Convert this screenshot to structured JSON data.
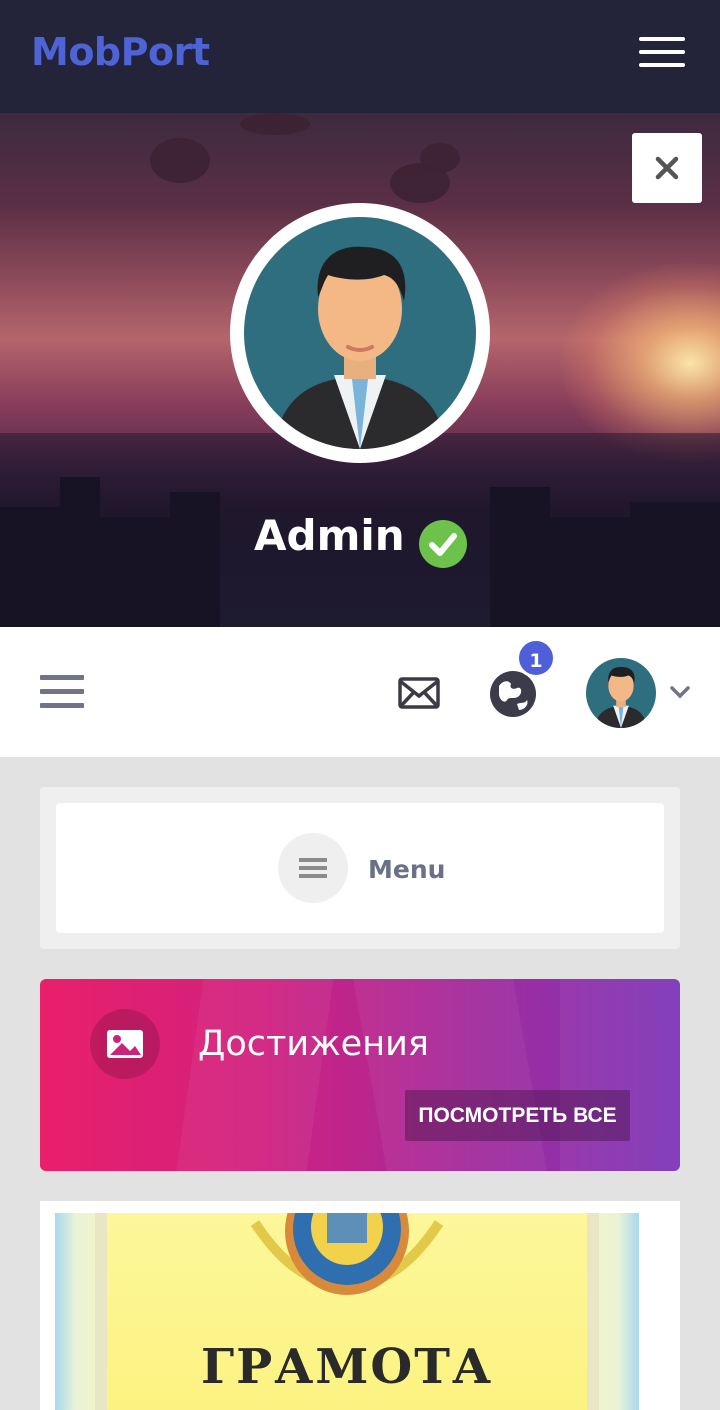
{
  "header": {
    "brand": "MobPort",
    "menu_icon": "hamburger-icon"
  },
  "profile": {
    "name": "Admin",
    "verified": true,
    "verified_icon": "check-circle-icon",
    "close_icon": "close-icon",
    "avatar": "user-avatar-businessman"
  },
  "toolbar": {
    "menu_icon": "hamburger-icon",
    "mail_icon": "envelope-icon",
    "globe_icon": "globe-icon",
    "notification_count": "1",
    "avatar": "user-avatar-businessman",
    "dropdown_icon": "chevron-down-icon"
  },
  "menu_card": {
    "label": "Menu",
    "icon": "list-icon"
  },
  "achievements": {
    "title": "Достижения",
    "button_label": "ПОСМОТРЕТЬ ВСЕ",
    "icon": "image-icon"
  },
  "certificate": {
    "title": "ГРАМОТА"
  },
  "colors": {
    "header_bg": "#23243a",
    "brand": "#4e64d6",
    "badge": "#4e5fd9",
    "verified": "#6cc24a",
    "achievements_gradient_start": "#e9206a",
    "achievements_gradient_end": "#7d36b8"
  }
}
